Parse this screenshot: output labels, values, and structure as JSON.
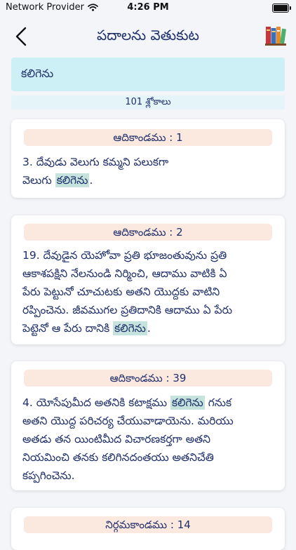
{
  "status": {
    "carrier": "Network Provider",
    "time": "4:26 PM"
  },
  "header": {
    "title": "పదాలను వెతుకుట"
  },
  "search": {
    "value": "కలిగెను"
  },
  "result_count": "101 శ్లోకాలు",
  "results": [
    {
      "ref": "ఆదికాండము : 1",
      "lines": [
        {
          "before": "3. దేవుడు వెలుగు కమ్మని  పలుకగా",
          "match": "",
          "after": ""
        },
        {
          "before": "వెలుగు ",
          "match": "కలిగెను",
          "after": "."
        }
      ]
    },
    {
      "ref": "ఆదికాండము : 2",
      "lines": [
        {
          "before": "19. దేవుడైన యెహోవా ప్రతి భూజంతువును ప్రతి",
          "match": "",
          "after": ""
        },
        {
          "before": "ఆకాశపక్షిని నేలనుండి నిర్మించి, ఆదాము వాటికి ఏ",
          "match": "",
          "after": ""
        },
        {
          "before": "పేరు పెట్టునో చూచుటకు అతని యొద్దకు వాటిని",
          "match": "",
          "after": ""
        },
        {
          "before": "రప్పించెను. జీవముగల ప్రతిదానికి ఆదాము ఏ పేరు",
          "match": "",
          "after": ""
        },
        {
          "before": "పెట్టెనో ఆ పేరు దానికి ",
          "match": "కలిగెను",
          "after": "."
        }
      ]
    },
    {
      "ref": "ఆదికాండము : 39",
      "lines": [
        {
          "before": "4. యోసేపుమీద అతనికి కటాక్షము ",
          "match": "కలిగెను",
          "after": " గనుక"
        },
        {
          "before": "అతని యొద్ద పరిచర్య చేయువాడాయెను. మరియు",
          "match": "",
          "after": ""
        },
        {
          "before": "అతడు తన యింటిమీద విచారణకర్తగా అతని",
          "match": "",
          "after": ""
        },
        {
          "before": "నియమించి తనకు కలిగినదంతయు అతనిచేతి",
          "match": "",
          "after": ""
        },
        {
          "before": "కప్పగించెను.",
          "match": "",
          "after": ""
        }
      ]
    },
    {
      "ref": "నిర్గమకాండము : 14",
      "lines": []
    }
  ]
}
